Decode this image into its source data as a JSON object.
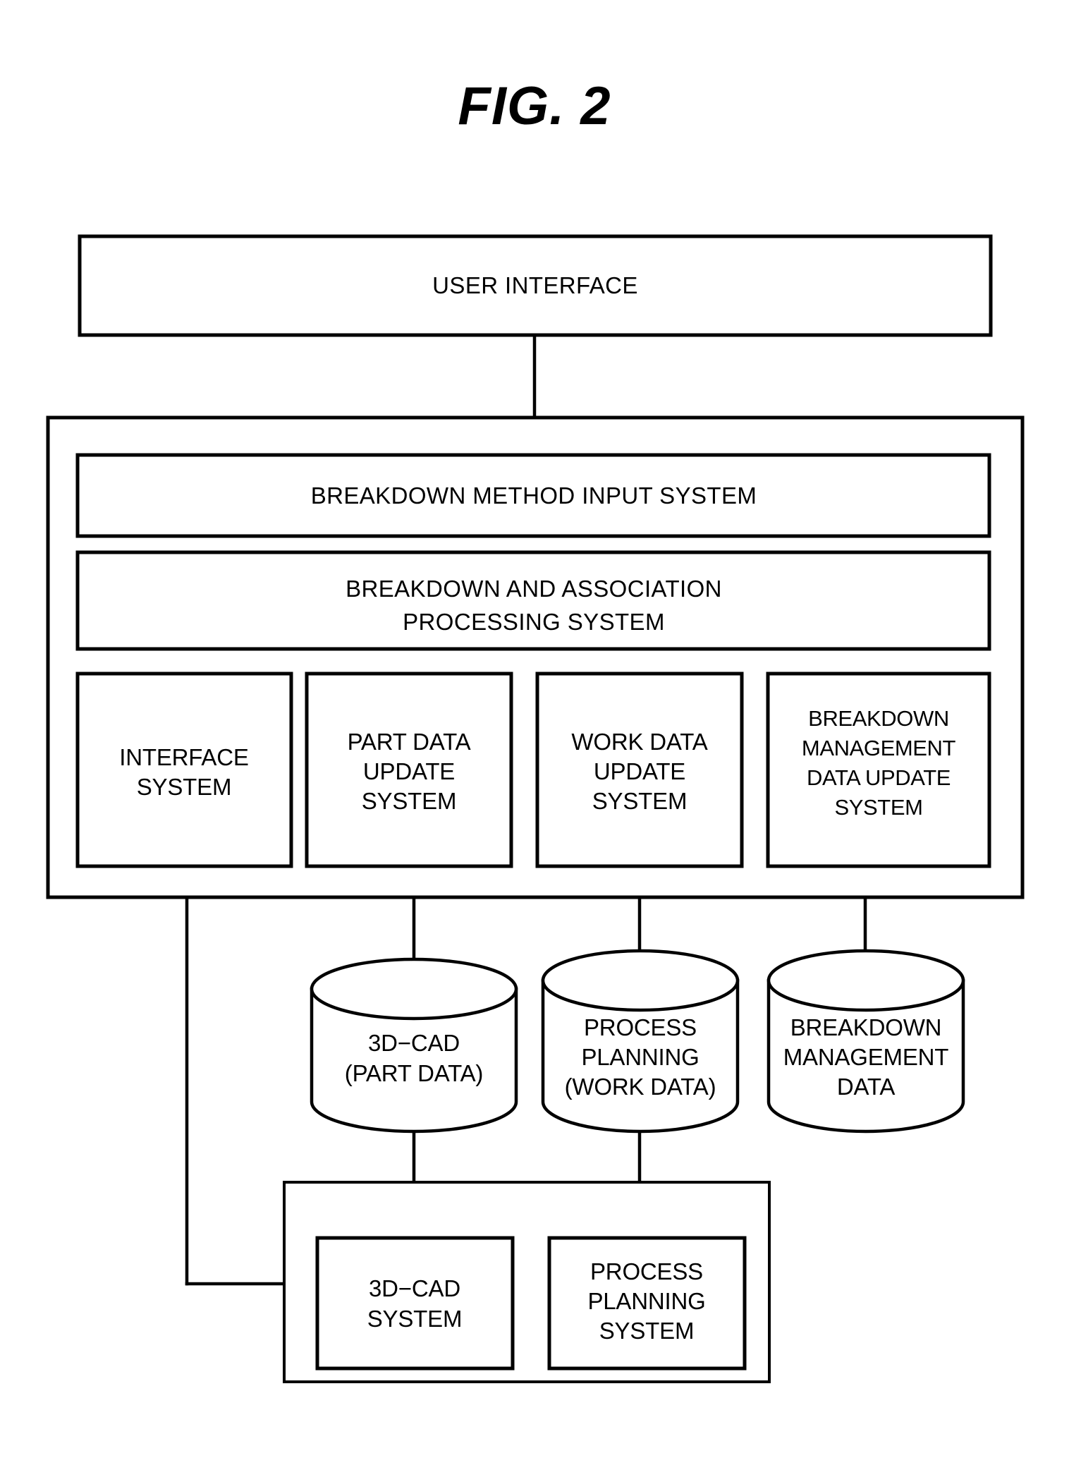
{
  "figure": {
    "title": "FIG. 2",
    "type": "patent-block-diagram"
  },
  "nodes": {
    "user_interface": {
      "label": "USER INTERFACE",
      "shape": "rectangle"
    },
    "breakdown_method_input_system": {
      "label": "BREAKDOWN METHOD INPUT SYSTEM",
      "shape": "rectangle"
    },
    "breakdown_and_association_processing_system": {
      "line1": "BREAKDOWN AND ASSOCIATION",
      "line2": "PROCESSING SYSTEM",
      "shape": "rectangle"
    },
    "interface_system": {
      "line1": "INTERFACE",
      "line2": "SYSTEM",
      "shape": "rectangle"
    },
    "part_data_update_system": {
      "line1": "PART DATA",
      "line2": "UPDATE",
      "line3": "SYSTEM",
      "shape": "rectangle"
    },
    "work_data_update_system": {
      "line1": "WORK DATA",
      "line2": "UPDATE",
      "line3": "SYSTEM",
      "shape": "rectangle"
    },
    "breakdown_management_data_update_system": {
      "line1": "BREAKDOWN",
      "line2": "MANAGEMENT",
      "line3": "DATA UPDATE",
      "line4": "SYSTEM",
      "shape": "rectangle"
    },
    "db_3d_cad_part_data": {
      "line1": "3D−CAD",
      "line2": "(PART DATA)",
      "shape": "cylinder"
    },
    "db_process_planning_work_data": {
      "line1": "PROCESS",
      "line2": "PLANNING",
      "line3": "(WORK DATA)",
      "shape": "cylinder"
    },
    "db_breakdown_management_data": {
      "line1": "BREAKDOWN",
      "line2": "MANAGEMENT",
      "line3": "DATA",
      "shape": "cylinder"
    },
    "cad_system": {
      "line1": "3D−CAD",
      "line2": "SYSTEM",
      "shape": "rectangle"
    },
    "process_planning_system": {
      "line1": "PROCESS",
      "line2": "PLANNING",
      "line3": "SYSTEM",
      "shape": "rectangle"
    }
  },
  "containers": {
    "main_system_container": {
      "label": ""
    },
    "external_systems_container": {
      "label": ""
    }
  },
  "colors": {
    "stroke": "#000000",
    "fill": "#ffffff",
    "text": "#000000"
  }
}
